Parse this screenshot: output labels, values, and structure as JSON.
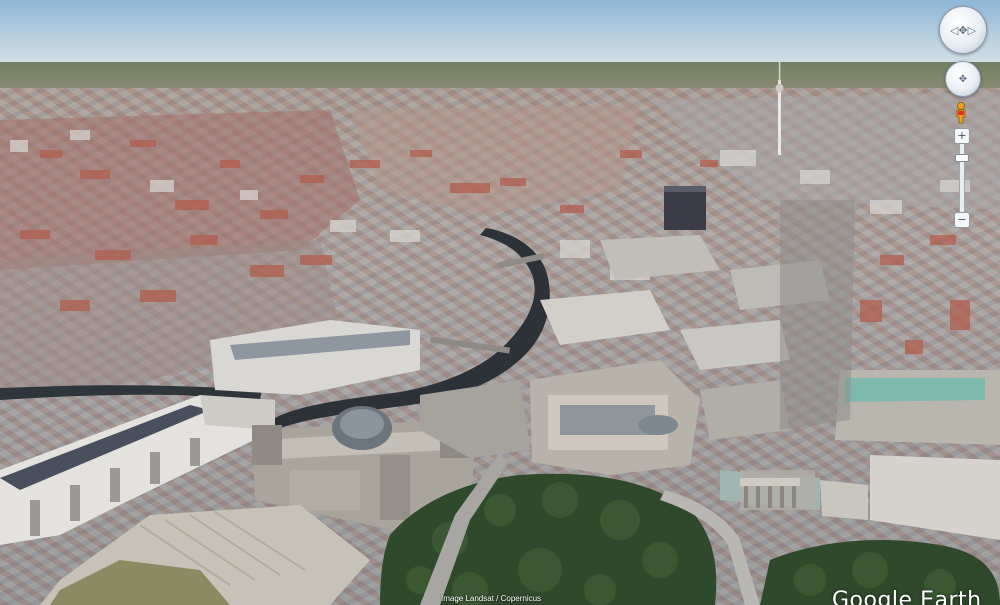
{
  "map": {
    "view": "3D aerial",
    "colors": {
      "sky": "#9dbfdb",
      "river": "#2c3238",
      "park": "#2f4a2a",
      "roof_red": "#a8594a",
      "building_light": "#d8d6d2"
    }
  },
  "navigation": {
    "look_control_icon": "look-around-icon",
    "move_control_icon": "move-pan-icon",
    "street_view_icon": "pegman-icon",
    "zoom_in_label": "+",
    "zoom_out_label": "−"
  },
  "footer": {
    "attribution": "Image Landsat / Copernicus",
    "logo": "Google Earth"
  }
}
